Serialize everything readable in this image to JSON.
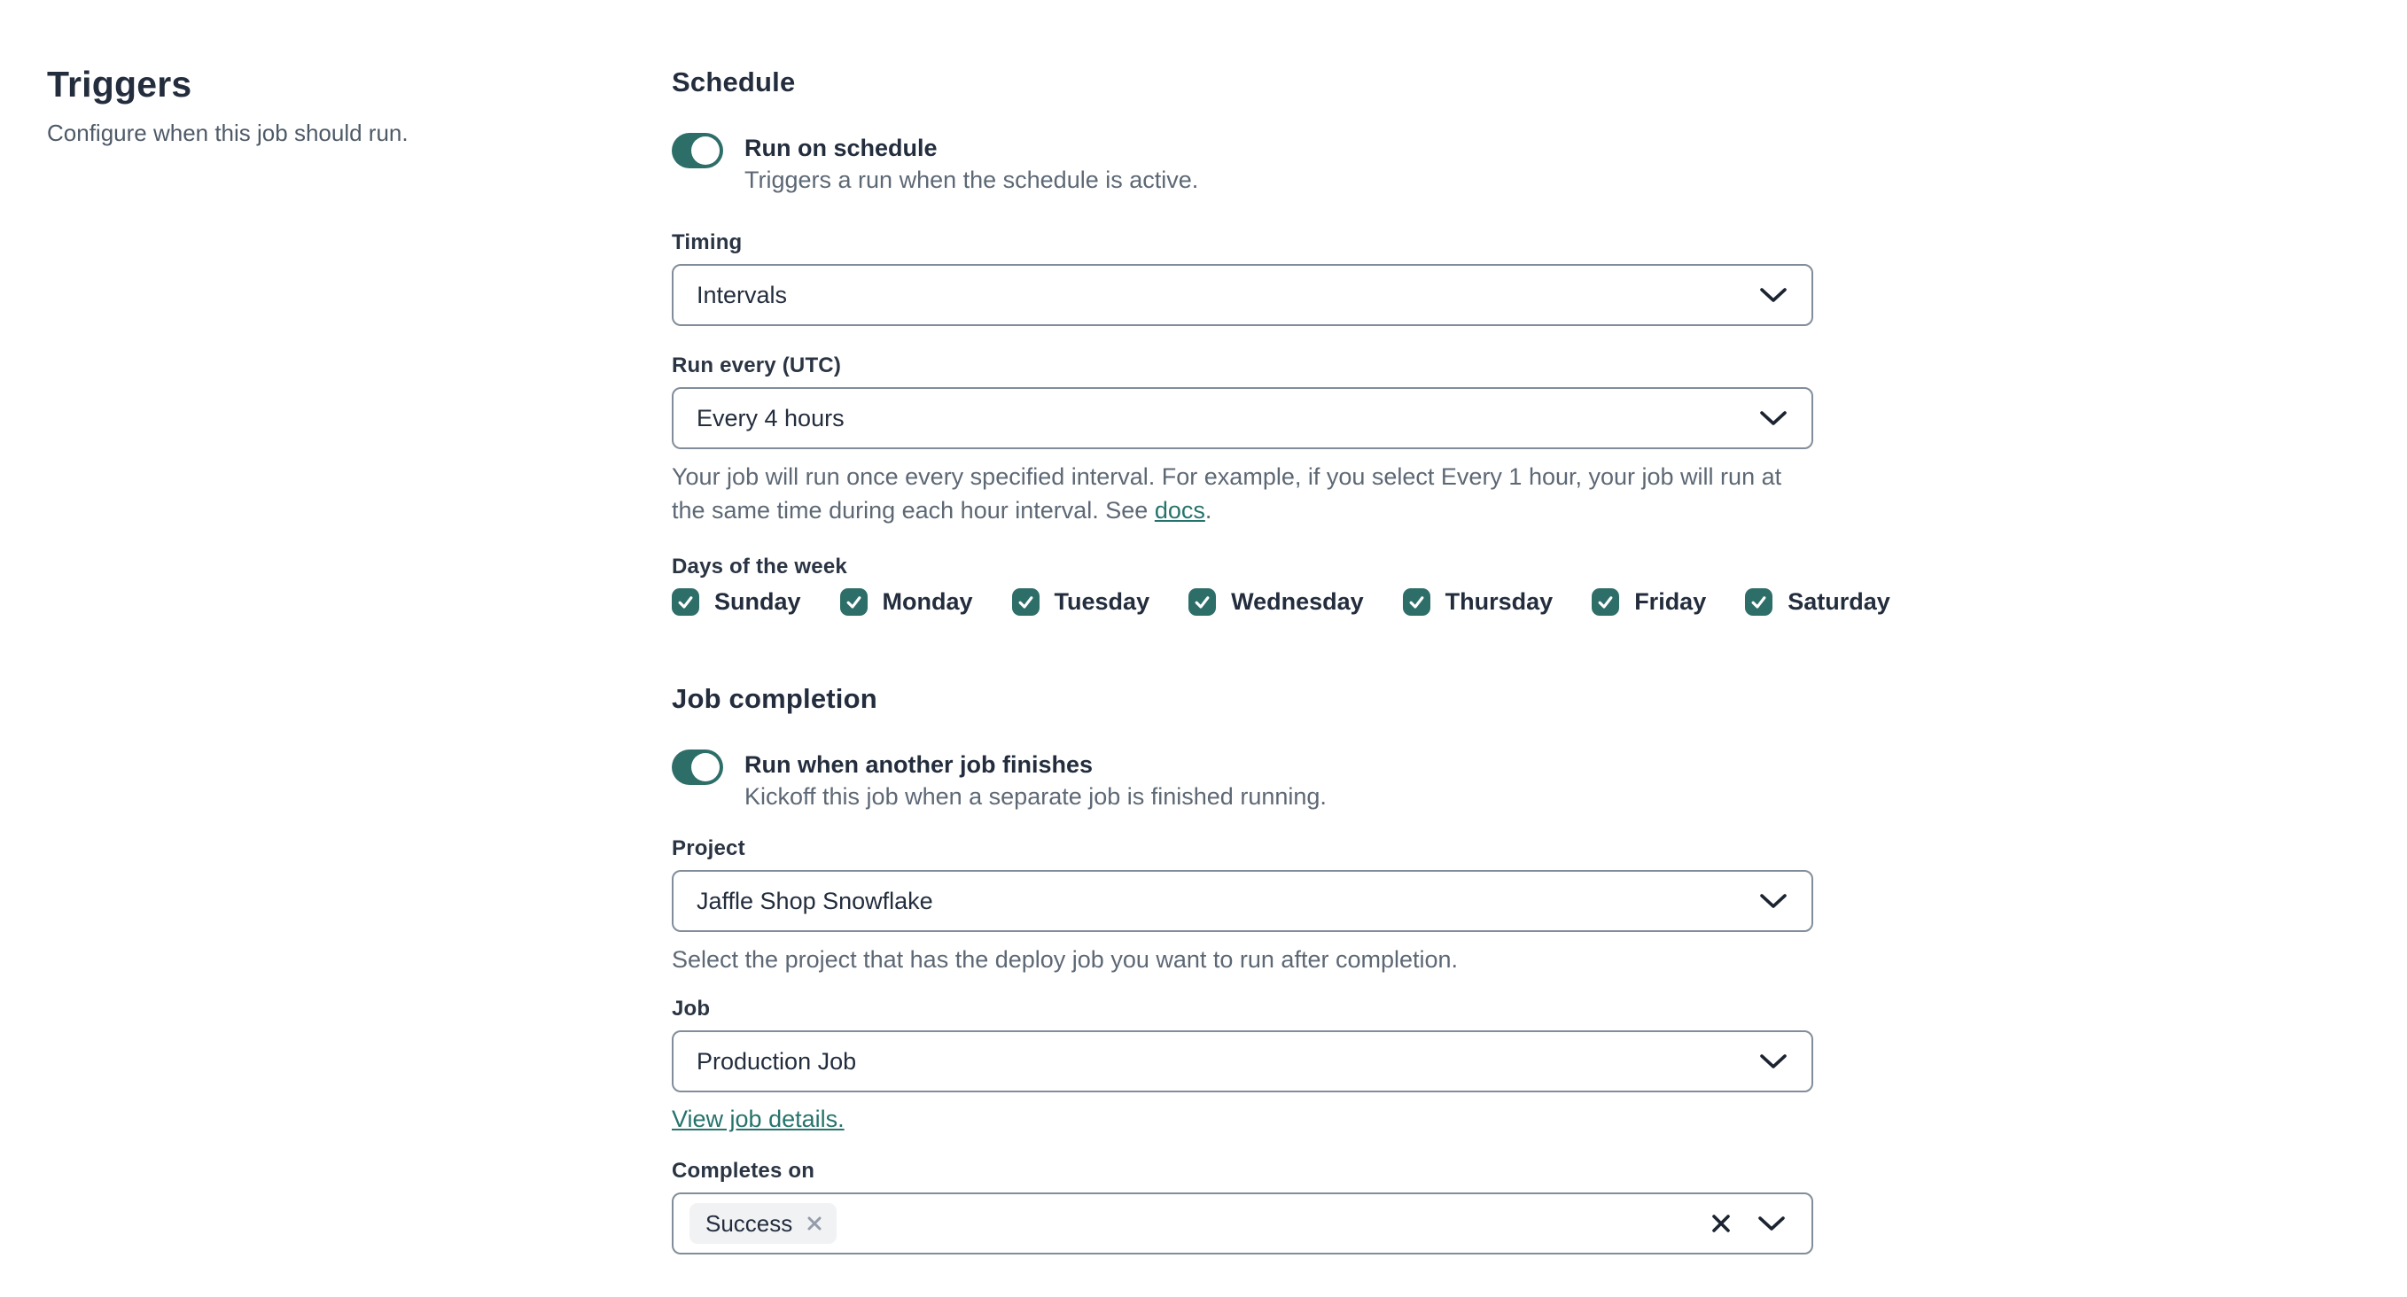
{
  "colors": {
    "accent_teal": "#2e6e69",
    "heading_navy": "#232d3d",
    "muted_text": "#5d6875",
    "field_border": "#828d9b",
    "tag_background": "#f1f2f4",
    "link_teal": "#26736d"
  },
  "sidebar": {
    "title": "Triggers",
    "subtitle": "Configure when this job should run."
  },
  "schedule": {
    "heading": "Schedule",
    "toggle": {
      "label": "Run on schedule",
      "description": "Triggers a run when the schedule is active.",
      "state": "on"
    },
    "timing": {
      "label": "Timing",
      "value": "Intervals"
    },
    "run_every": {
      "label": "Run every (UTC)",
      "value": "Every 4 hours",
      "help_before_link": "Your job will run once every specified interval. For example, if you select Every 1 hour, your job will run at the same time during each hour interval. See ",
      "help_link": "docs",
      "help_after_link": "."
    },
    "days": {
      "label": "Days of the week",
      "items": [
        "Sunday",
        "Monday",
        "Tuesday",
        "Wednesday",
        "Thursday",
        "Friday",
        "Saturday"
      ],
      "checked": [
        true,
        true,
        true,
        true,
        true,
        true,
        true
      ]
    }
  },
  "job_completion": {
    "heading": "Job completion",
    "toggle": {
      "label": "Run when another job finishes",
      "description": "Kickoff this job when a separate job is finished running.",
      "state": "on"
    },
    "project": {
      "label": "Project",
      "value": "Jaffle Shop Snowflake",
      "help": "Select the project that has the deploy job you want to run after completion."
    },
    "job": {
      "label": "Job",
      "value": "Production Job",
      "link": "View job details."
    },
    "completes_on": {
      "label": "Completes on",
      "selected": [
        "Success"
      ]
    }
  }
}
